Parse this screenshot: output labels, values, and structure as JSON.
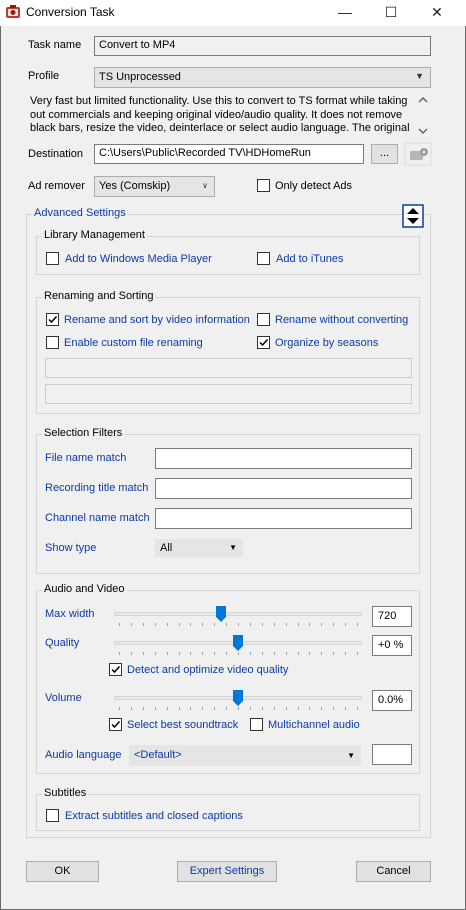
{
  "window": {
    "title": "Conversion Task",
    "minimize": "—",
    "maximize": "☐",
    "close": "✕"
  },
  "task_name": {
    "label": "Task name",
    "value": "Convert to MP4"
  },
  "profile": {
    "label": "Profile",
    "value": "TS Unprocessed",
    "description": "Very fast but limited functionality. Use this to convert to TS format while taking out commercials and keeping original video/audio quality. It does not remove black bars, resize the video, deinterlace or select audio language. The original"
  },
  "destination": {
    "label": "Destination",
    "value": "C:\\Users\\Public\\Recorded TV\\HDHomeRun",
    "browse_label": "..."
  },
  "ad_remover": {
    "label": "Ad remover",
    "value": "Yes (Comskip)",
    "only_detect_label": "Only detect Ads",
    "only_detect_checked": false
  },
  "advanced": {
    "label": "Advanced Settings"
  },
  "library": {
    "title": "Library Management",
    "wmp_label": "Add to Windows Media Player",
    "wmp_checked": false,
    "itunes_label": "Add to iTunes",
    "itunes_checked": false
  },
  "renaming": {
    "title": "Renaming and Sorting",
    "rename_sort_label": "Rename and sort by video information",
    "rename_sort_checked": true,
    "rename_without_label": "Rename without converting",
    "rename_without_checked": false,
    "custom_label": "Enable custom file renaming",
    "custom_checked": false,
    "seasons_label": "Organize by seasons",
    "seasons_checked": true,
    "custom_pattern": "",
    "custom_preview": ""
  },
  "filters": {
    "title": "Selection Filters",
    "file_name_label": "File name match",
    "file_name_value": "",
    "recording_title_label": "Recording title match",
    "recording_title_value": "",
    "channel_label": "Channel name match",
    "channel_value": "",
    "show_type_label": "Show type",
    "show_type_value": "All"
  },
  "av": {
    "title": "Audio and Video",
    "max_width_label": "Max width",
    "max_width_value": "720",
    "max_width_level": 0.43,
    "quality_label": "Quality",
    "quality_value": "+0 %",
    "quality_level": 0.5,
    "detect_label": "Detect and optimize video quality",
    "detect_checked": true,
    "volume_label": "Volume",
    "volume_value": "0.0%",
    "volume_level": 0.5,
    "soundtrack_label": "Select best soundtrack",
    "soundtrack_checked": true,
    "multichannel_label": "Multichannel audio",
    "multichannel_checked": false,
    "audio_language_label": "Audio language",
    "audio_language_value": "<Default>",
    "audio_language_extra": ""
  },
  "subtitles": {
    "title": "Subtitles",
    "extract_label": "Extract subtitles and closed captions",
    "extract_checked": false
  },
  "buttons": {
    "ok": "OK",
    "expert": "Expert Settings",
    "cancel": "Cancel"
  },
  "colors": {
    "accent_blue": "#0b3aa6",
    "thumb_blue": "#0078d7",
    "window_bg": "#f0f0f0"
  }
}
